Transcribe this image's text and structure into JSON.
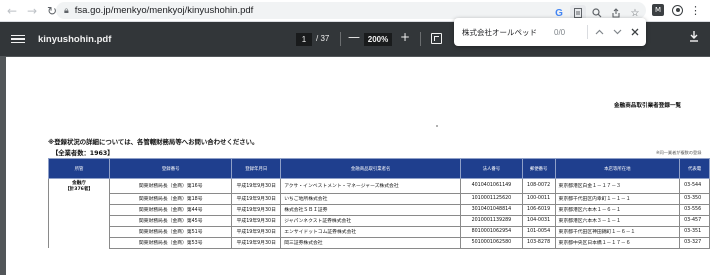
{
  "browser": {
    "url": "fsa.go.jp/menkyo/menkyoj/kinyushohin.pdf",
    "right_icons": [
      "G",
      "pdf-file-icon",
      "zoom-icon",
      "share-icon",
      "bookmark-star-icon",
      "M",
      "record-icon",
      "more-icon"
    ]
  },
  "find_bar": {
    "query": "株式会社オールペッド",
    "count": "0/0"
  },
  "pdf_toolbar": {
    "filename": "kinyushohin.pdf",
    "current_page": "1",
    "total_pages": "/ 37",
    "zoom": "200%",
    "minus": "—",
    "plus": "+"
  },
  "page": {
    "doc_title": "金融商品取引業者登録一覧",
    "notice": "※登録状況の詳細については、各管轄財務局等へお問い合わせください。",
    "total": "【全業者数：1963】",
    "note_right": "※同一業者が複数の登録",
    "headers": [
      "所管",
      "登録番号",
      "登録年月日",
      "金融商品取引業者名",
      "法人番号",
      "郵便番号",
      "本店等所在地",
      "代表電"
    ],
    "jurisdiction_line1": "金融庁",
    "jurisdiction_line2": "【計376者】",
    "rows": [
      {
        "reg": "関東財務局長（金商）第16号",
        "date": "平成19年9月30日",
        "name": "アクサ・インベストメント・マネージャーズ株式会社",
        "corp": "4010401061149",
        "zip": "108-0072",
        "addr": "東京都港区白金１－１７－３",
        "tel": "03-544"
      },
      {
        "reg": "関東財務局長（金商）第18号",
        "date": "平成19年9月30日",
        "name": "いちご地所株式会社",
        "corp": "1010001125620",
        "zip": "100-0011",
        "addr": "東京都千代田区内幸町１－１－１",
        "tel": "03-350"
      },
      {
        "reg": "関東財務局長（金商）第44号",
        "date": "平成19年9月30日",
        "name": "株式会社ＳＢＩ証券",
        "corp": "3010401048814",
        "zip": "106-6019",
        "addr": "東京都港区六本木１－６－１",
        "tel": "03-556"
      },
      {
        "reg": "関東財務局長（金商）第45号",
        "date": "平成19年9月30日",
        "name": "ジャパンネクスト証券株式会社",
        "corp": "2010001139289",
        "zip": "104-0031",
        "addr": "東京都港区六本木３－１－１",
        "tel": "03-457"
      },
      {
        "reg": "関東財務局長（金商）第51号",
        "date": "平成19年9月30日",
        "name": "エンサイドットコム証券株式会社",
        "corp": "8010001062954",
        "zip": "101-0054",
        "addr": "東京都千代田区神田錦町１－６－１",
        "tel": "03-351"
      },
      {
        "reg": "関東財務局長（金商）第53号",
        "date": "平成19年9月30日",
        "name": "岡三証券株式会社",
        "corp": "5010001062580",
        "zip": "103-8278",
        "addr": "東京都中央区日本橋１－１７－６",
        "tel": "03-327"
      }
    ]
  }
}
